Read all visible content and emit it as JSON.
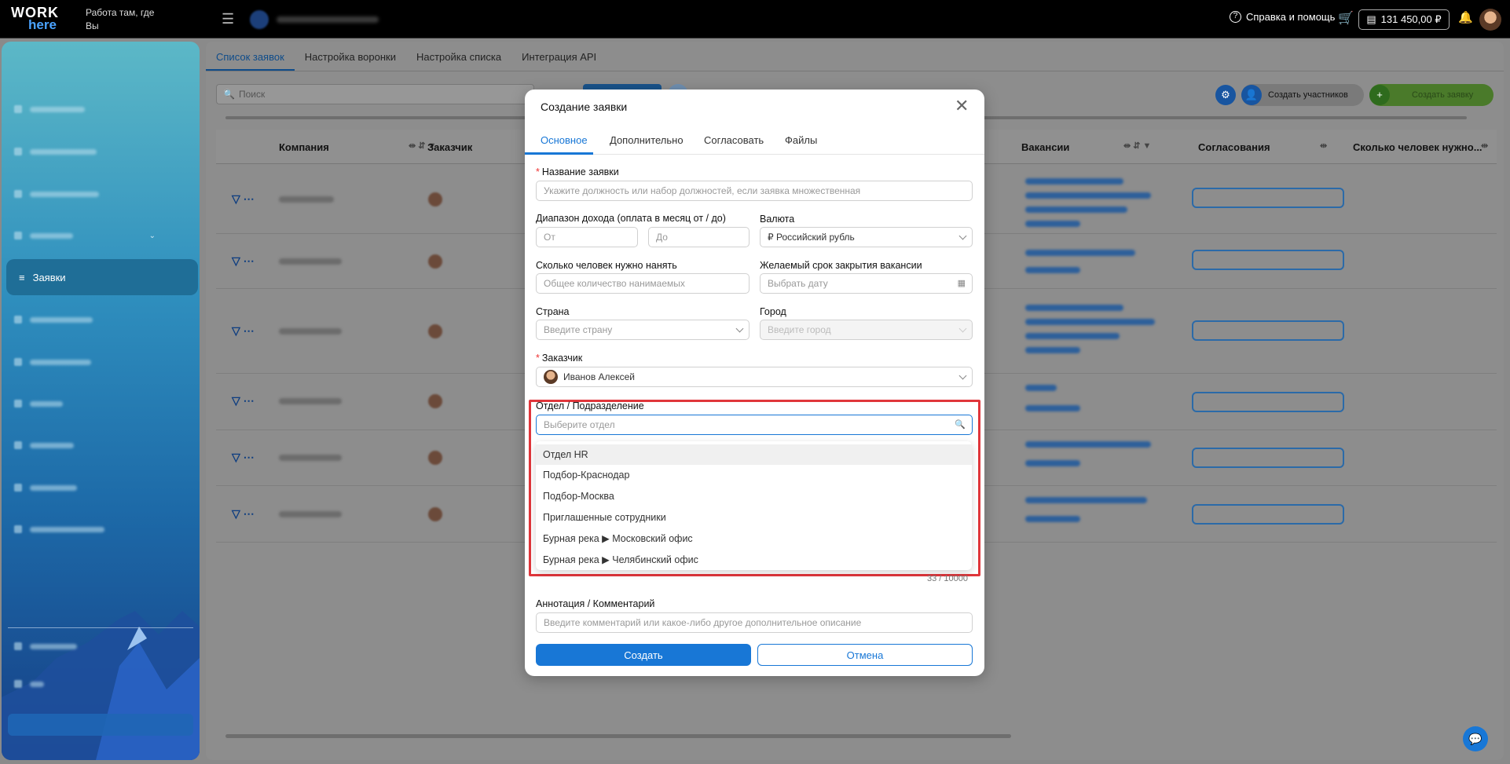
{
  "header": {
    "logo_line1": "WORK",
    "logo_line2": "here",
    "slogan": "Работа там, где Вы",
    "help_label": "Справка и помощь",
    "balance": "131 450,00 ₽"
  },
  "sidebar": {
    "active_item": "Заявки"
  },
  "tabs": [
    "Список заявок",
    "Настройка воронки",
    "Настройка списка",
    "Интеграция API"
  ],
  "toolbar": {
    "search_placeholder": "Поиск",
    "create_participants": "Создать участников",
    "create_request": "Создать заявку"
  },
  "table": {
    "columns": [
      "Компания",
      "Заказчик",
      "Вакансии",
      "Согласования",
      "Сколько человек нужно..."
    ]
  },
  "modal": {
    "title": "Создание заявки",
    "tabs": [
      "Основное",
      "Дополнительно",
      "Согласовать",
      "Файлы"
    ],
    "fields": {
      "name_label": "Название заявки",
      "name_placeholder": "Укажите должность или набор должностей, если заявка множественная",
      "income_label": "Диапазон дохода (оплата в месяц от / до)",
      "income_from": "От",
      "income_to": "До",
      "currency_label": "Валюта",
      "currency_value": "₽ Российский рубль",
      "headcount_label": "Сколько человек нужно нанять",
      "headcount_placeholder": "Общее количество нанимаемых",
      "deadline_label": "Желаемый срок закрытия вакансии",
      "deadline_placeholder": "Выбрать дату",
      "country_label": "Страна",
      "country_placeholder": "Введите страну",
      "city_label": "Город",
      "city_placeholder": "Введите город",
      "customer_label": "Заказчик",
      "customer_value": "Иванов Алексей",
      "dept_label": "Отдел / Подразделение",
      "dept_placeholder": "Выберите отдел",
      "counter": "33 / 10000",
      "comment_label": "Аннотация / Комментарий",
      "comment_placeholder": "Введите комментарий или какое-либо другое дополнительное описание"
    },
    "dept_options": [
      "Отдел HR",
      "Подбор-Краснодар",
      "Подбор-Москва",
      "Приглашенные сотрудники",
      "Бурная река ▶ Московский офис",
      "Бурная река ▶ Челябинский офис"
    ],
    "create_button": "Создать",
    "cancel_button": "Отмена"
  }
}
